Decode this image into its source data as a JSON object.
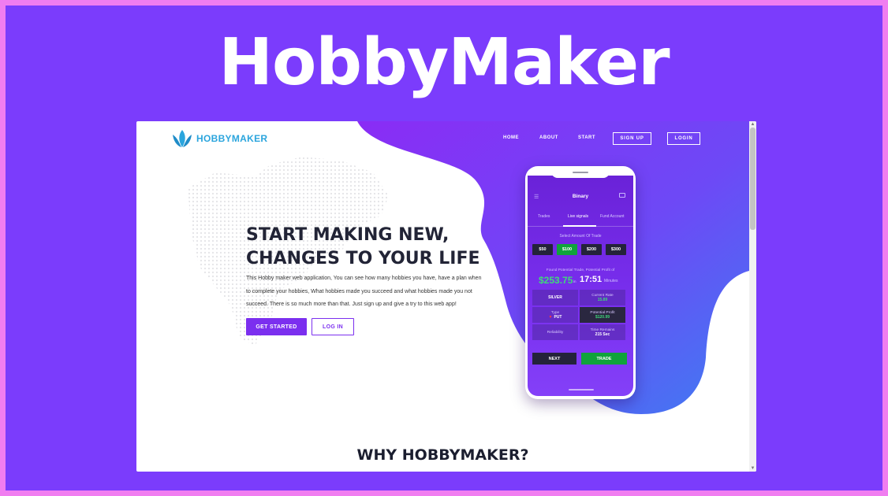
{
  "hero": {
    "title": "HobbyMaker"
  },
  "site": {
    "logo_text": "HOBBYMAKER",
    "nav": {
      "home": "HOME",
      "about": "ABOUT",
      "start": "START",
      "signup": "SIGN UP",
      "login": "LOGIN"
    },
    "headline_line1": "START MAKING NEW,",
    "headline_line2": "CHANGES TO YOUR LIFE",
    "description_line1": "This Hobby maker web application, You can see how many hobbies you have, have a plan when",
    "description_line2": "to complete your hobbies, What hobbies made you succeed and what hobbies made you not",
    "description_line3": "succeed. There is so much more than that. Just sign up and give a try to this web app!",
    "get_started": "GET STARTED",
    "log_in": "LOG IN",
    "why_heading": "WHY HOBBYMAKER?"
  },
  "phone_app": {
    "title": "Binary",
    "tabs": [
      "Trades",
      "Live signals",
      "Fund Account"
    ],
    "active_tab": "Live signals",
    "select_label": "Select Amount Of Trade",
    "amounts": [
      "$50",
      "$100",
      "$200",
      "$300"
    ],
    "selected_amount": "$100",
    "found_label": "Found Potential Trade, Potential Profit of",
    "profit": "$253.75",
    "in_label": "in",
    "time": "17:51",
    "minutes_label": "Minutes",
    "cells": {
      "tier": "SILVER",
      "current_rate_label": "Current Rate",
      "current_rate_value": "15.89",
      "type_label": "Type",
      "type_value": "PUT",
      "potential_profit_label": "Potential Profit",
      "potential_profit_value": "$120.99",
      "reliability_label": "Reliability",
      "time_remains_label": "Time Remains",
      "time_remains_value": "215 Sec"
    },
    "next": "NEXT",
    "trade": "TRADE"
  },
  "colors": {
    "frame_bg": "#7b3cfc",
    "border": "#f07df0",
    "accent_purple": "#7b2fef",
    "logo_blue": "#2ba5dd",
    "green": "#10a33b",
    "dark_text": "#222436"
  }
}
